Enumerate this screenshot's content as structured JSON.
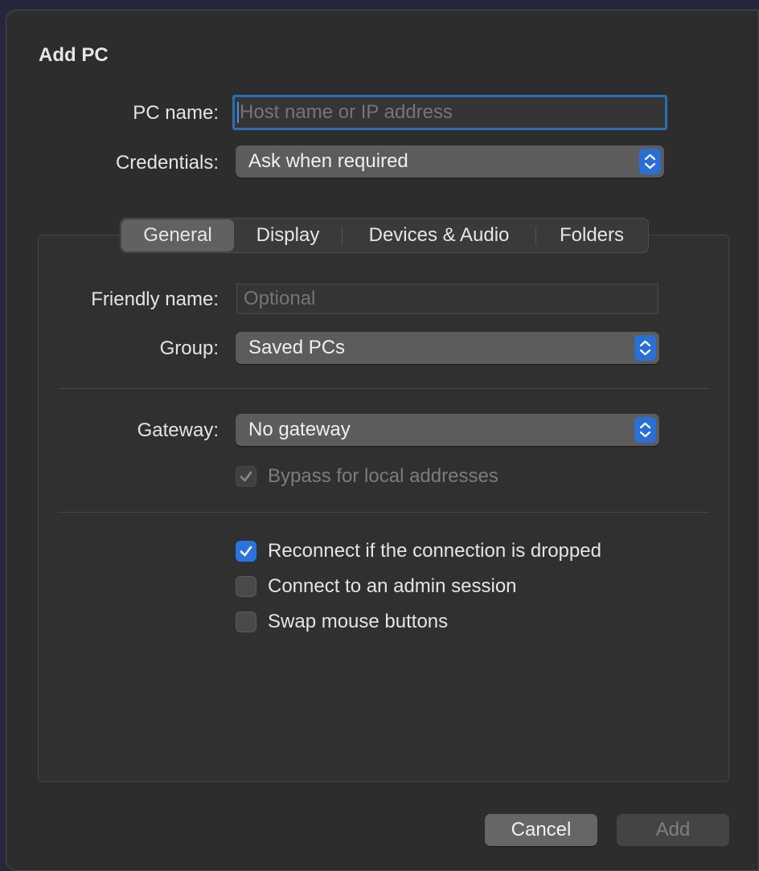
{
  "dialog": {
    "title": "Add PC"
  },
  "pc_name": {
    "label": "PC name:",
    "value": "",
    "placeholder": "Host name or IP address"
  },
  "credentials": {
    "label": "Credentials:",
    "selected": "Ask when required"
  },
  "tabs": [
    {
      "label": "General",
      "selected": true
    },
    {
      "label": "Display",
      "selected": false
    },
    {
      "label": "Devices & Audio",
      "selected": false
    },
    {
      "label": "Folders",
      "selected": false
    }
  ],
  "friendly_name": {
    "label": "Friendly name:",
    "value": "",
    "placeholder": "Optional"
  },
  "group": {
    "label": "Group:",
    "selected": "Saved PCs"
  },
  "gateway": {
    "label": "Gateway:",
    "selected": "No gateway"
  },
  "bypass": {
    "label": "Bypass for local addresses",
    "checked": true,
    "enabled": false
  },
  "options": [
    {
      "label": "Reconnect if the connection is dropped",
      "checked": true
    },
    {
      "label": "Connect to an admin session",
      "checked": false
    },
    {
      "label": "Swap mouse buttons",
      "checked": false
    }
  ],
  "buttons": {
    "cancel": "Cancel",
    "add": "Add"
  },
  "colors": {
    "accent": "#2a73e0",
    "background": "#2d2d2d"
  }
}
